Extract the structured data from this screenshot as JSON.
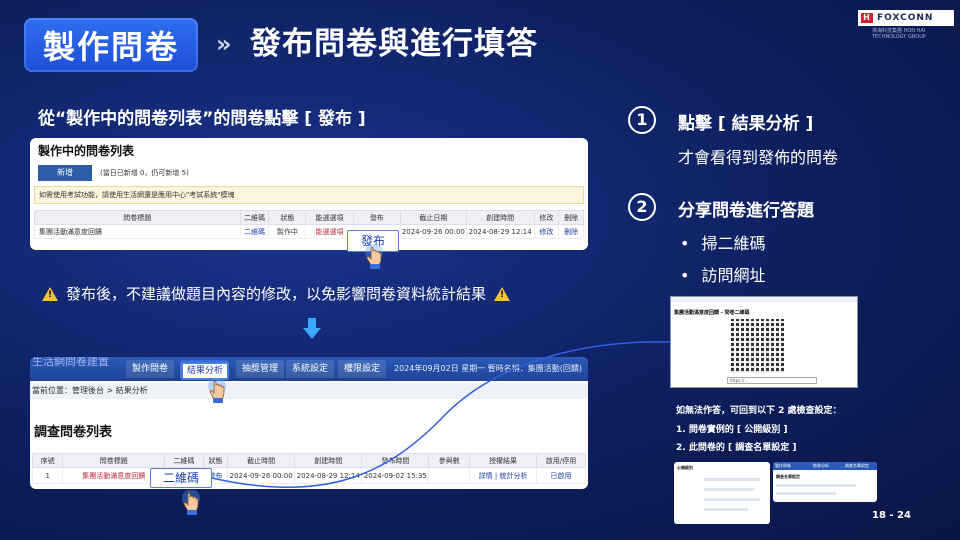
{
  "header": {
    "title": "製作問卷",
    "chevron": "»",
    "subtitle": "發布問卷與進行填答",
    "brand": "FOXCONN",
    "brand_mark": "H",
    "brand_sub": "鴻海科技集團 HON HAI TECHNOLOGY GROUP"
  },
  "left": {
    "instruction": "從“製作中的問卷列表”的問卷點擊 [ 發布 ]",
    "warning": "發布後，不建議做題目內容的修改，以免影響問卷資料統計結果"
  },
  "shot1": {
    "title": "製作中的問卷列表",
    "new_button": "新增",
    "quota_note": "(當日已新增 0，仍可新增 5)",
    "warning_bar": "如需使用考試功能，請使用生活網還是應用中心\"考試系統\"模塊",
    "columns": [
      "問卷標題",
      "二維碼",
      "狀態",
      "能選選項",
      "發布",
      "截止日期",
      "創建時間",
      "修改",
      "刪除"
    ],
    "row": [
      "集團活動滿意度回饋",
      "二維碼",
      "製作中",
      "能選選項",
      "",
      "2024-09-26 00:00",
      "2024-08-29 12:14",
      "修改",
      "刪除"
    ],
    "publish_label": "發布"
  },
  "shot2": {
    "system_name": "生活網問卷建置",
    "tabs": [
      "製作問卷",
      "結果分析",
      "抽獎管理",
      "系統設定",
      "權限設定"
    ],
    "nav_info": "2024年09月02日 星期一 暫時名稱：集團活動(回饋)",
    "breadcrumb": "當前位置：管理後台 > 結果分析",
    "list_title": "調查問卷列表",
    "columns": [
      "序號",
      "問卷標題",
      "二維碼",
      "狀態",
      "截止時間",
      "創建時間",
      "發布時間",
      "參與數",
      "授權結果",
      "啟用/停用"
    ],
    "row": [
      "1",
      "集團活動滿意度回饋",
      "",
      "發布",
      "2024-09-26 00:00",
      "2024-08-29 12:14",
      "2024-09-02 15:35",
      "",
      "詳情 | 統計分析",
      "已啟用"
    ],
    "qr_label": "二維碼"
  },
  "steps": [
    {
      "num": "1",
      "title": "點擊 [ 結果分析 ]",
      "desc": "才會看得到發佈的問卷"
    },
    {
      "num": "2",
      "title": "分享問卷進行答題",
      "bullets": [
        "掃二維碼",
        "訪問網址"
      ]
    }
  ],
  "dialog": {
    "title": "集團活動滿意度回饋 - 問卷二維碼",
    "url": "https://..."
  },
  "notes": {
    "head": "如無法作答，可回到以下 2 處檢查設定：",
    "items": [
      "1.   問卷實例的 [ 公開級別 ]",
      "2.   此問卷的 [ 調查名單設定 ]"
    ]
  },
  "thumb1": {
    "title": "公開級別"
  },
  "thumb2": {
    "title": "調查名單設定",
    "tabs": [
      "製作問卷",
      "結果分析",
      "調查名單設定"
    ]
  },
  "page_number": "18 - 24",
  "colors": {
    "accent": "#2f6ff0",
    "background": "#0e1f5e",
    "link": "#1b3fa5"
  }
}
